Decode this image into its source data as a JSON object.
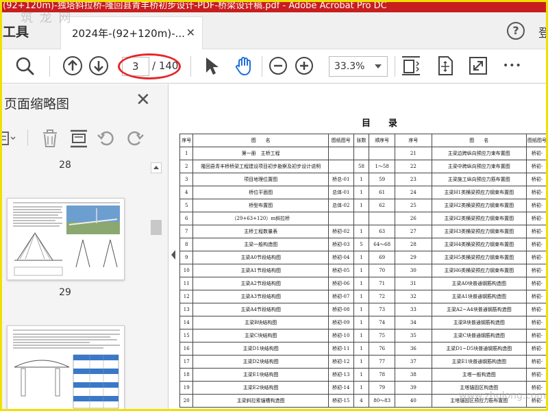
{
  "window": {
    "title": "(92+120m)-独塔斜拉桥-隆回县青丰桥初步设计-PDF-桥梁设计稿.pdf - Adobe Acrobat Pro DC"
  },
  "tabbar": {
    "tools_label": "工具",
    "tab_label": "2024年-(92+120m)-...",
    "close": "✕",
    "help": "?",
    "user_cut": "登"
  },
  "toolbar": {
    "current_page": "3",
    "total_pages": "/ 140",
    "zoom": "33.3%",
    "more": "•••"
  },
  "panel": {
    "title": "页面缩略图",
    "close": "✕",
    "thumbnails": [
      {
        "label": "28"
      },
      {
        "label": "29"
      }
    ]
  },
  "document": {
    "heading": "目录",
    "columns": [
      "序号",
      "图　　名",
      "图纸图号",
      "张数",
      "顺序号",
      "序号",
      "图　　名",
      "图纸图号"
    ],
    "rows": [
      [
        "1",
        "第一册　主桥工程",
        "",
        "",
        "",
        "21",
        "主梁边跨纵向预应力束布置图",
        "桥初-"
      ],
      [
        "2",
        "隆回县青丰桥桥梁工程建设项目初步勘察及初步设计说明",
        "",
        "58",
        "1～58",
        "22",
        "主梁中跨纵向预应力束布置图",
        "桥初-"
      ],
      [
        "3",
        "项目地理位置图",
        "桥总-01",
        "1",
        "59",
        "23",
        "主梁施工纵向预应力筋布置图",
        "桥初-"
      ],
      [
        "4",
        "桥位平面图",
        "总体-01",
        "1",
        "61",
        "24",
        "主梁H1类横梁预应力钢束布置图",
        "桥初-"
      ],
      [
        "5",
        "桥型布置图",
        "总体-02",
        "1",
        "62",
        "25",
        "主梁H2类横梁预应力钢束布置图",
        "桥初-"
      ],
      [
        "6",
        "（29+63+120）m斜拉桥",
        "",
        "",
        "",
        "26",
        "主梁H2类横梁预应力钢束布置图",
        "桥初-"
      ],
      [
        "7",
        "主桥工程数量表",
        "桥初-02",
        "1",
        "63",
        "27",
        "主梁H3类横梁预应力钢束布置图",
        "桥初-"
      ],
      [
        "8",
        "主梁一般构造图",
        "桥初-03",
        "5",
        "64～68",
        "28",
        "主梁H4类横梁预应力钢束布置图",
        "桥初-"
      ],
      [
        "9",
        "主梁A0节段结构图",
        "桥初-04",
        "1",
        "69",
        "29",
        "主梁H5类横梁预应力钢束布置图",
        "桥初-"
      ],
      [
        "10",
        "主梁A1节段结构图",
        "桥初-05",
        "1",
        "70",
        "30",
        "主梁H6类横梁预应力钢束布置图",
        "桥初-"
      ],
      [
        "11",
        "主梁A2节段结构图",
        "桥初-06",
        "1",
        "71",
        "31",
        "主梁A0块普通钢筋构造图",
        "桥初-"
      ],
      [
        "12",
        "主梁A3节段结构图",
        "桥初-07",
        "1",
        "72",
        "32",
        "主梁A1块普通钢筋构造图",
        "桥初-"
      ],
      [
        "13",
        "主梁A4节段结构图",
        "桥初-08",
        "1",
        "73",
        "33",
        "主梁A2~A4块普通钢筋构造图",
        "桥初-"
      ],
      [
        "14",
        "主梁B块结构图",
        "桥初-09",
        "1",
        "74",
        "34",
        "主梁B块普通钢筋构造图",
        "桥初-"
      ],
      [
        "15",
        "主梁C块结构图",
        "桥初-10",
        "1",
        "75",
        "35",
        "主梁C块普通钢筋构造图",
        "桥初-"
      ],
      [
        "16",
        "主梁D1块结构图",
        "桥初-11",
        "1",
        "76",
        "36",
        "主梁D1~D5块普通钢筋构造图",
        "桥初-"
      ],
      [
        "17",
        "主梁D2块结构图",
        "桥初-12",
        "1",
        "77",
        "37",
        "主梁E1块普通钢筋构造图",
        "桥初-"
      ],
      [
        "18",
        "主梁E1块结构图",
        "桥初-13",
        "1",
        "78",
        "38",
        "主塔一般构造图",
        "桥初-"
      ],
      [
        "19",
        "主梁E2块结构图",
        "桥初-14",
        "1",
        "79",
        "39",
        "主塔锚固区构造图",
        "桥初-"
      ],
      [
        "20",
        "主梁斜拉索锚槽构造图",
        "桥初-15",
        "4",
        "80～83",
        "40",
        "主塔锚固区预应力筋布置图",
        "桥初-"
      ]
    ]
  },
  "watermark": {
    "top_left": "筑 龙 网",
    "bottom_right": "www.zhulong.com"
  },
  "colors": {
    "titlebar": "#c81e1e",
    "highlight_ring": "#e8262a",
    "frame": "#f0e000"
  }
}
